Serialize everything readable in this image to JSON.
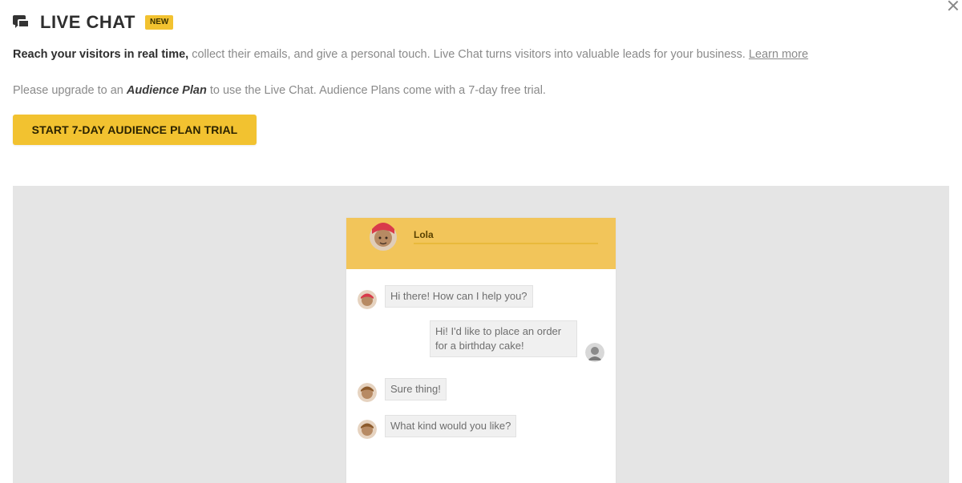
{
  "header": {
    "title": "LIVE CHAT",
    "badge": "NEW"
  },
  "description": {
    "lead": "Reach your visitors in real time,",
    "body": " collect their emails, and give a personal touch. Live Chat turns visitors into valuable leads for your business.",
    "link": "Learn more"
  },
  "upgrade": {
    "before": "Please upgrade to an ",
    "plan": "Audience Plan",
    "after": " to use the Live Chat. Audience Plans come with a 7-day free trial."
  },
  "cta": {
    "label": "START 7-DAY AUDIENCE PLAN TRIAL"
  },
  "preview": {
    "agent_name": "Lola",
    "messages": [
      {
        "from": "agent",
        "text": "Hi there! How can I help you?"
      },
      {
        "from": "visitor",
        "text": "Hi! I'd like to place an order for a birthday cake!"
      },
      {
        "from": "agent",
        "text": "Sure thing!"
      },
      {
        "from": "agent",
        "text": "What kind would you like?"
      }
    ]
  },
  "colors": {
    "accent": "#f2c230",
    "chat_header": "#f2c55a",
    "preview_bg": "#e5e5e5"
  },
  "icons": [
    "chat-bubbles-icon",
    "close-icon",
    "agent-avatar-icon",
    "visitor-avatar-icon"
  ]
}
